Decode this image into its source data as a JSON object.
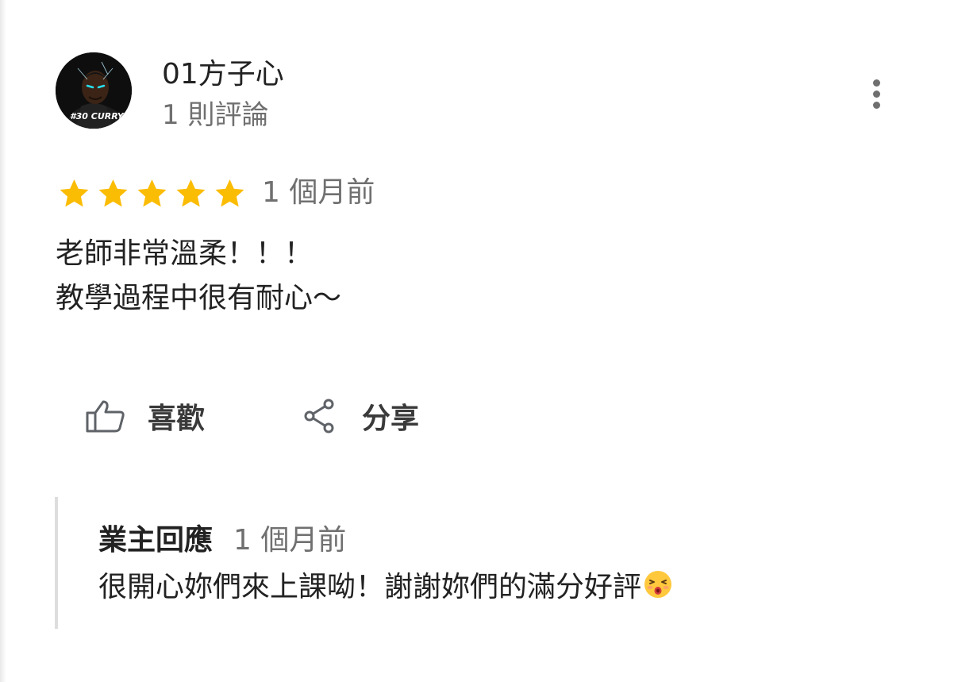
{
  "reviewer": {
    "name": "01方子心",
    "review_count": "1 則評論",
    "avatar_text": "#30 CURRY"
  },
  "review": {
    "rating": 5,
    "rating_max": 5,
    "star_color": "#FBBC04",
    "date": "1 個月前",
    "lines": [
      "老師非常溫柔！！！",
      "教學過程中很有耐心～"
    ]
  },
  "actions": {
    "like_label": "喜歡",
    "like_icon": "thumbs-up-icon",
    "share_label": "分享",
    "share_icon": "share-icon"
  },
  "menu": {
    "icon": "more-vert-icon"
  },
  "owner_reply": {
    "label": "業主回應",
    "date": "1 個月前",
    "text": "很開心妳們來上課呦！謝謝妳們的滿分好評",
    "emoji_icon": "kissing-face-emoji"
  },
  "colors": {
    "text_primary": "#222222",
    "text_secondary": "#707070",
    "icon": "#5f6368",
    "reply_bar": "#dddddd"
  }
}
